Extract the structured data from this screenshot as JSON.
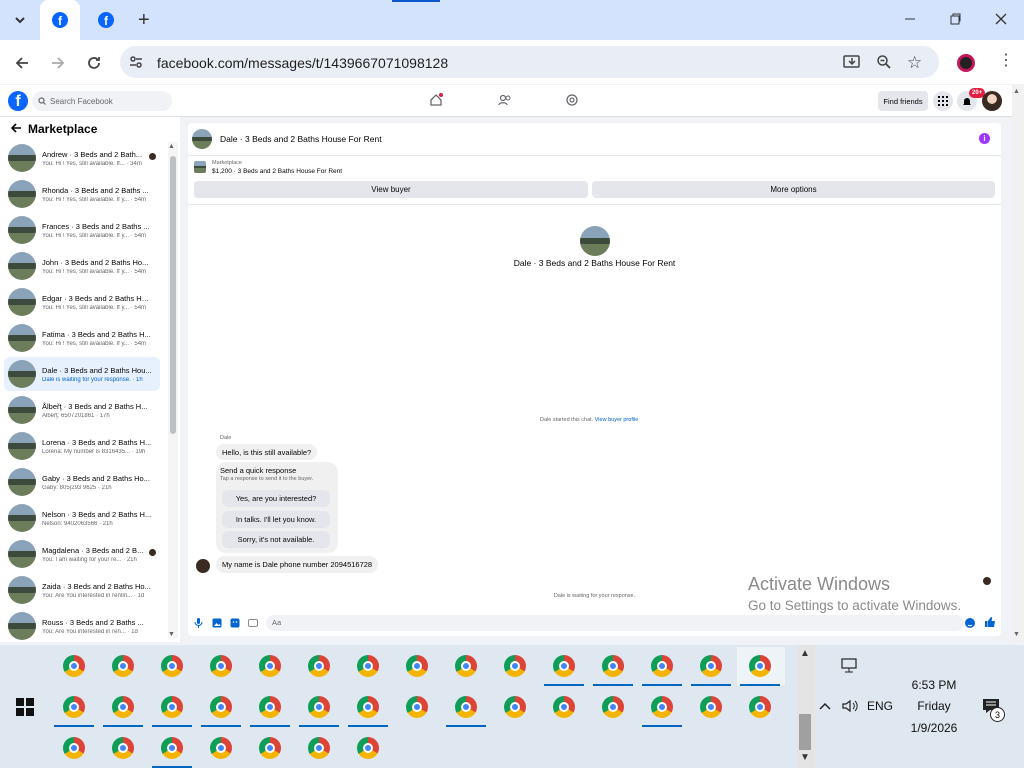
{
  "browser": {
    "url": "facebook.com/messages/t/1439667071098128",
    "new_tab": "+"
  },
  "fb": {
    "search_placeholder": "Search Facebook",
    "find_friends": "Find friends",
    "notif_badge": "20+"
  },
  "sidebar": {
    "title": "Marketplace",
    "conversations": [
      {
        "name": "Andrew · 3 Beds and 2 Bath...",
        "preview": "You: Hi ! Yes, still available. If... · 34m"
      },
      {
        "name": "Rhonda · 3 Beds and 2 Baths ...",
        "preview": "You: Hi ! Yes, still available. If y... · 54m"
      },
      {
        "name": "Frances · 3 Beds and 2 Baths ...",
        "preview": "You: Hi ! Yes, still available. If y... · 54m"
      },
      {
        "name": "John · 3 Beds and 2 Baths Ho...",
        "preview": "You: Hi ! Yes, still available. If y... · 54m"
      },
      {
        "name": "Edgar · 3 Beds and 2 Baths Ho...",
        "preview": "You: Hi ! Yes, still available. If y... · 54m"
      },
      {
        "name": "Fatima · 3 Beds and 2 Baths H...",
        "preview": "You: Hi ! Yes, still available. If y... · 54m"
      },
      {
        "name": "Dale · 3 Beds and 2 Baths Hou...",
        "preview": "Dale is waiting for your response. · 1h"
      },
      {
        "name": "Ålbeřţ · 3 Beds and 2 Baths H...",
        "preview": "Ålbeřţ: 6507201861 · 17h"
      },
      {
        "name": "Lorena · 3 Beds and 2 Baths H...",
        "preview": "Lorena: My number is 8316435... · 19h"
      },
      {
        "name": "Gaby · 3 Beds and 2 Baths Ho...",
        "preview": "Gaby: 805|293 9625 · 21h"
      },
      {
        "name": "Nelson · 3 Beds and 2 Baths H...",
        "preview": "Nelson: 9402063566 · 21h"
      },
      {
        "name": "Magdalena · 3 Beds and 2 B...",
        "preview": "You: I am waiting for your re... · 21h"
      },
      {
        "name": "Zaida · 3 Beds and 2 Baths Ho...",
        "preview": "You: Are You interested in rentin... · 1d"
      },
      {
        "name": "Rouss · 3 Beds and 2 Baths ...",
        "preview": "You: Are You interested in ren... · 1d"
      }
    ]
  },
  "chat": {
    "header_title": "Dale · 3 Beds and 2 Baths House For Rent",
    "listing_label": "Marketplace",
    "listing_detail": "$1,200 · 3 Beds and 2 Baths House For Rent",
    "view_buyer": "View buyer",
    "more_options": "More options",
    "center_title": "Dale · 3 Beds and 2 Baths House For Rent",
    "started_text": "Dale started this chat.",
    "view_profile": "View buyer profile",
    "sender_name": "Dale",
    "msg1": "Hello, is this still available?",
    "quick_title": "Send a quick response",
    "quick_sub": "Tap a response to send it to the buyer.",
    "quick_options": [
      "Yes, are you interested?",
      "In talks. I'll let you know.",
      "Sorry, it's not available."
    ],
    "msg2": "My name is Dale phone number 2094516728",
    "waiting": "Dale is waiting for your response.",
    "input_placeholder": "Aa"
  },
  "watermark": {
    "line1": "Activate Windows",
    "line2": "Go to Settings to activate Windows."
  },
  "taskbar": {
    "time": "6:53 PM",
    "day": "Friday",
    "date": "1/9/2026",
    "lang": "ENG",
    "notif_count": "3"
  }
}
